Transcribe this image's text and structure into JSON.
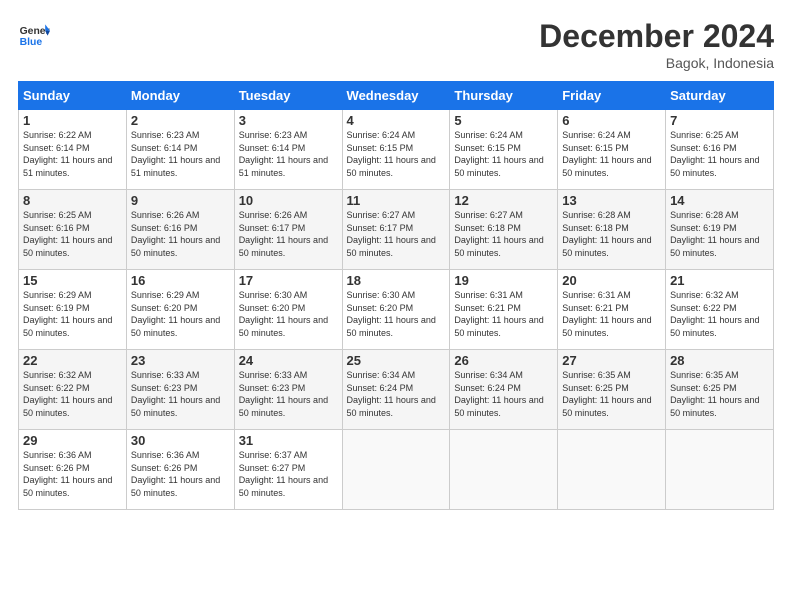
{
  "logo": {
    "line1": "General",
    "line2": "Blue"
  },
  "title": "December 2024",
  "subtitle": "Bagok, Indonesia",
  "days_header": [
    "Sunday",
    "Monday",
    "Tuesday",
    "Wednesday",
    "Thursday",
    "Friday",
    "Saturday"
  ],
  "weeks": [
    [
      {
        "num": "1",
        "sunrise": "6:22 AM",
        "sunset": "6:14 PM",
        "daylight": "11 hours and 51 minutes."
      },
      {
        "num": "2",
        "sunrise": "6:23 AM",
        "sunset": "6:14 PM",
        "daylight": "11 hours and 51 minutes."
      },
      {
        "num": "3",
        "sunrise": "6:23 AM",
        "sunset": "6:14 PM",
        "daylight": "11 hours and 51 minutes."
      },
      {
        "num": "4",
        "sunrise": "6:24 AM",
        "sunset": "6:15 PM",
        "daylight": "11 hours and 50 minutes."
      },
      {
        "num": "5",
        "sunrise": "6:24 AM",
        "sunset": "6:15 PM",
        "daylight": "11 hours and 50 minutes."
      },
      {
        "num": "6",
        "sunrise": "6:24 AM",
        "sunset": "6:15 PM",
        "daylight": "11 hours and 50 minutes."
      },
      {
        "num": "7",
        "sunrise": "6:25 AM",
        "sunset": "6:16 PM",
        "daylight": "11 hours and 50 minutes."
      }
    ],
    [
      {
        "num": "8",
        "sunrise": "6:25 AM",
        "sunset": "6:16 PM",
        "daylight": "11 hours and 50 minutes."
      },
      {
        "num": "9",
        "sunrise": "6:26 AM",
        "sunset": "6:16 PM",
        "daylight": "11 hours and 50 minutes."
      },
      {
        "num": "10",
        "sunrise": "6:26 AM",
        "sunset": "6:17 PM",
        "daylight": "11 hours and 50 minutes."
      },
      {
        "num": "11",
        "sunrise": "6:27 AM",
        "sunset": "6:17 PM",
        "daylight": "11 hours and 50 minutes."
      },
      {
        "num": "12",
        "sunrise": "6:27 AM",
        "sunset": "6:18 PM",
        "daylight": "11 hours and 50 minutes."
      },
      {
        "num": "13",
        "sunrise": "6:28 AM",
        "sunset": "6:18 PM",
        "daylight": "11 hours and 50 minutes."
      },
      {
        "num": "14",
        "sunrise": "6:28 AM",
        "sunset": "6:19 PM",
        "daylight": "11 hours and 50 minutes."
      }
    ],
    [
      {
        "num": "15",
        "sunrise": "6:29 AM",
        "sunset": "6:19 PM",
        "daylight": "11 hours and 50 minutes."
      },
      {
        "num": "16",
        "sunrise": "6:29 AM",
        "sunset": "6:20 PM",
        "daylight": "11 hours and 50 minutes."
      },
      {
        "num": "17",
        "sunrise": "6:30 AM",
        "sunset": "6:20 PM",
        "daylight": "11 hours and 50 minutes."
      },
      {
        "num": "18",
        "sunrise": "6:30 AM",
        "sunset": "6:20 PM",
        "daylight": "11 hours and 50 minutes."
      },
      {
        "num": "19",
        "sunrise": "6:31 AM",
        "sunset": "6:21 PM",
        "daylight": "11 hours and 50 minutes."
      },
      {
        "num": "20",
        "sunrise": "6:31 AM",
        "sunset": "6:21 PM",
        "daylight": "11 hours and 50 minutes."
      },
      {
        "num": "21",
        "sunrise": "6:32 AM",
        "sunset": "6:22 PM",
        "daylight": "11 hours and 50 minutes."
      }
    ],
    [
      {
        "num": "22",
        "sunrise": "6:32 AM",
        "sunset": "6:22 PM",
        "daylight": "11 hours and 50 minutes."
      },
      {
        "num": "23",
        "sunrise": "6:33 AM",
        "sunset": "6:23 PM",
        "daylight": "11 hours and 50 minutes."
      },
      {
        "num": "24",
        "sunrise": "6:33 AM",
        "sunset": "6:23 PM",
        "daylight": "11 hours and 50 minutes."
      },
      {
        "num": "25",
        "sunrise": "6:34 AM",
        "sunset": "6:24 PM",
        "daylight": "11 hours and 50 minutes."
      },
      {
        "num": "26",
        "sunrise": "6:34 AM",
        "sunset": "6:24 PM",
        "daylight": "11 hours and 50 minutes."
      },
      {
        "num": "27",
        "sunrise": "6:35 AM",
        "sunset": "6:25 PM",
        "daylight": "11 hours and 50 minutes."
      },
      {
        "num": "28",
        "sunrise": "6:35 AM",
        "sunset": "6:25 PM",
        "daylight": "11 hours and 50 minutes."
      }
    ],
    [
      {
        "num": "29",
        "sunrise": "6:36 AM",
        "sunset": "6:26 PM",
        "daylight": "11 hours and 50 minutes."
      },
      {
        "num": "30",
        "sunrise": "6:36 AM",
        "sunset": "6:26 PM",
        "daylight": "11 hours and 50 minutes."
      },
      {
        "num": "31",
        "sunrise": "6:37 AM",
        "sunset": "6:27 PM",
        "daylight": "11 hours and 50 minutes."
      },
      null,
      null,
      null,
      null
    ]
  ]
}
